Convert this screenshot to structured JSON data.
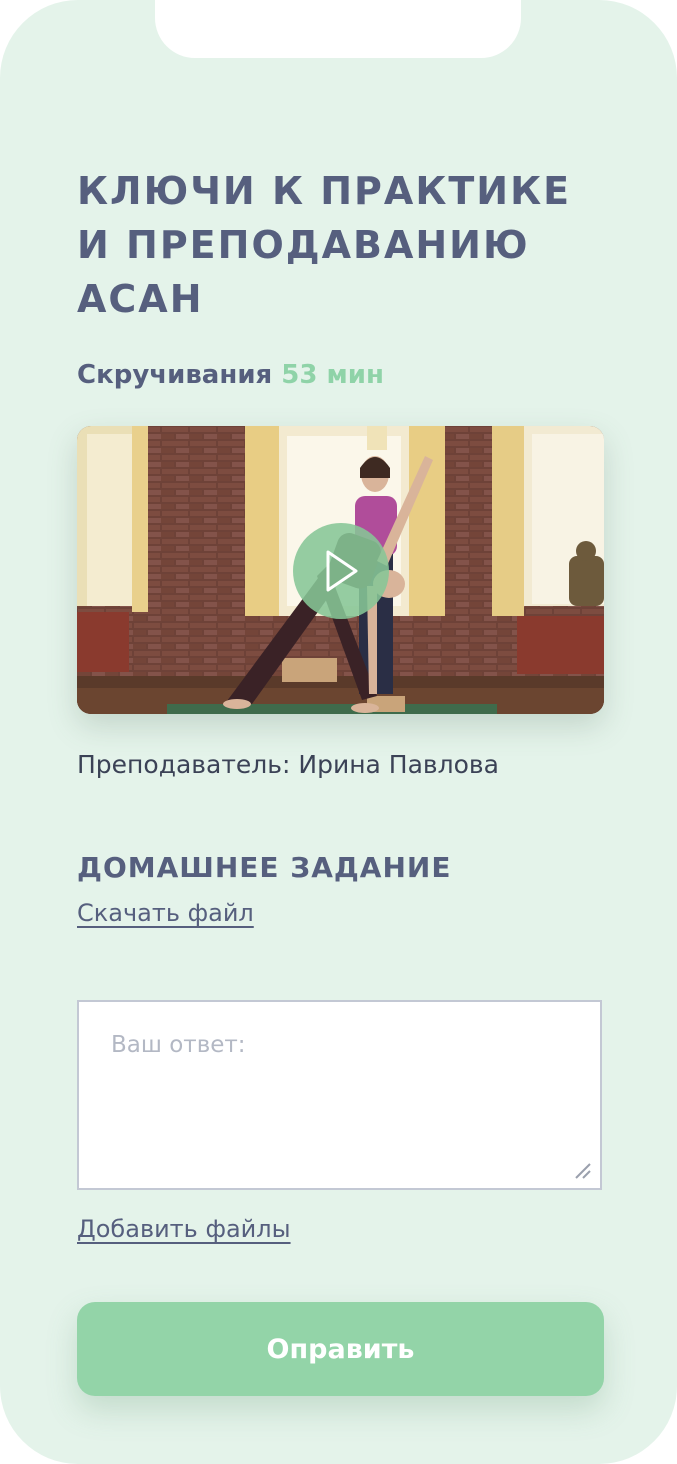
{
  "course": {
    "title": "КЛЮЧИ К ПРАКТИКЕ И ПРЕПОДАВАНИЮ АСАН"
  },
  "lesson": {
    "name": "Скручивания",
    "duration": "53 мин"
  },
  "video": {
    "play_icon": "play-icon"
  },
  "teacher": {
    "label": "Преподаватель: Ирина Павлова"
  },
  "homework": {
    "title": "ДОМАШНЕЕ ЗАДАНИЕ",
    "download_label": "Скачать файл",
    "answer_placeholder": "Ваш ответ:",
    "add_files_label": "Добавить файлы",
    "submit_label": "Оправить"
  },
  "colors": {
    "background": "#e4f3ea",
    "heading": "#565f7e",
    "accent_green": "#93d4a8",
    "text": "#3b4256"
  }
}
